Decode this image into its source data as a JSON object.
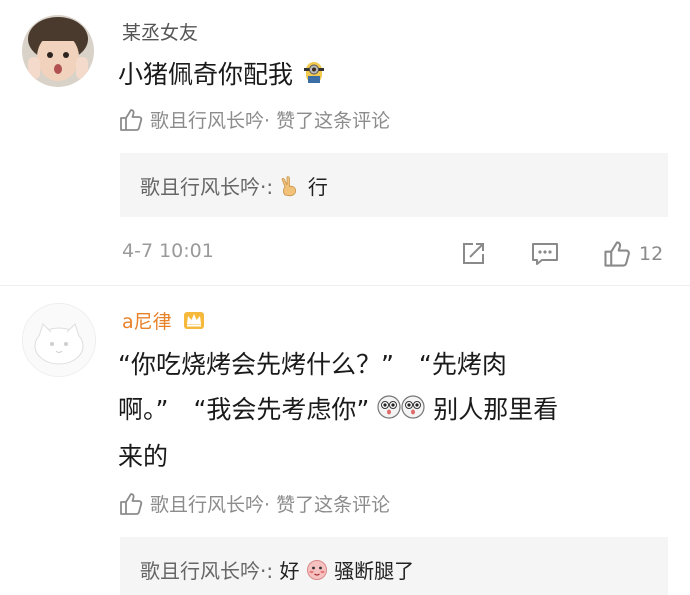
{
  "comments": [
    {
      "username": "某丞女友",
      "text": "小猪佩奇你配我",
      "liked_by": "歌且行风长吟· 赞了这条评论",
      "reply": {
        "author": "歌且行风长吟·:",
        "text": "行"
      },
      "time": "4-7 10:01",
      "like_count": "12"
    },
    {
      "username": "a尼律",
      "text_line1": "“你吃烧烤会先烤什么？”　“先烤肉",
      "text_line2_a": "啊。”　“我会先考虑你”",
      "text_line2_b": "别人那里看",
      "text_line3": "来的",
      "liked_by": "歌且行风长吟· 赞了这条评论",
      "reply": {
        "author": "歌且行风长吟·:",
        "text_a": "好",
        "text_b": "骚断腿了"
      }
    }
  ],
  "icons": {
    "like": "thumbs-up-icon",
    "share": "share-icon",
    "comment": "comment-icon",
    "vip": "crown-icon"
  },
  "colors": {
    "username_vip": "#e8822a",
    "meta": "#8c8c8c",
    "reply_bg": "#f5f5f5"
  }
}
